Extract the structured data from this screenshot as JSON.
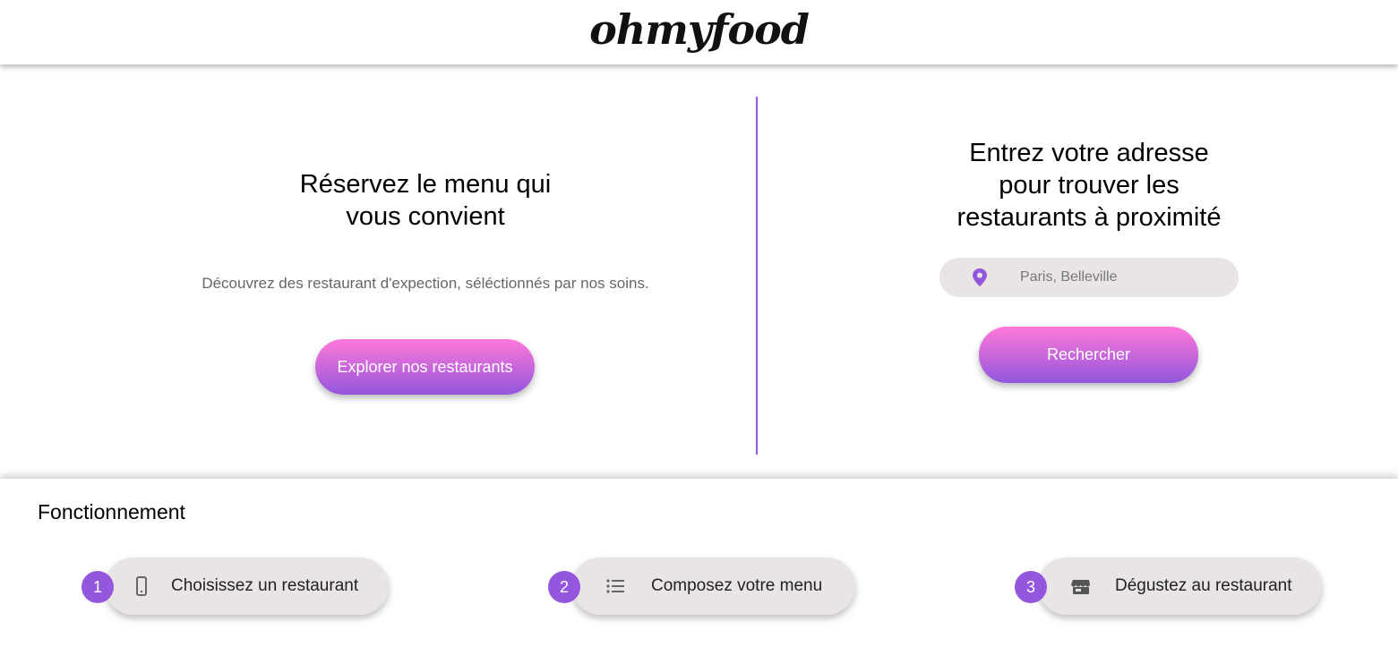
{
  "header": {
    "logo": "ohmyfood"
  },
  "hero": {
    "left": {
      "title_line1": "Réservez le menu qui",
      "title_line2": "vous convient",
      "description": "Découvrez des restaurant d'expection, séléctionnés par nos soins.",
      "button_label": "Explorer nos restaurants"
    },
    "right": {
      "title_line1": "Entrez votre adresse",
      "title_line2": "pour trouver les",
      "title_line3": "restaurants à proximité",
      "search_icon": "location-pin-icon",
      "search_placeholder": "Paris, Belleville",
      "search_value": "",
      "button_label": "Rechercher"
    }
  },
  "how_it_works": {
    "title": "Fonctionnement",
    "steps": [
      {
        "number": "1",
        "icon": "mobile-phone-icon",
        "label": "Choisissez un restaurant"
      },
      {
        "number": "2",
        "icon": "list-icon",
        "label": "Composez votre menu"
      },
      {
        "number": "3",
        "icon": "storefront-icon",
        "label": "Dégustez au restaurant"
      }
    ]
  },
  "colors": {
    "accent_purple": "#9356DC",
    "accent_pink": "#FF79DA",
    "pill_gray": "#E8E5E4"
  }
}
